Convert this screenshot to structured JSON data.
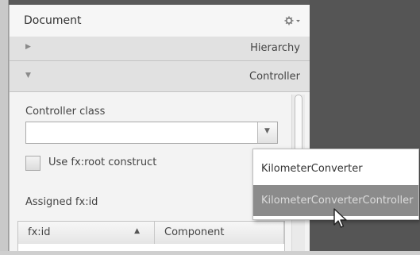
{
  "panel": {
    "title": "Document",
    "settings_icon": "gear-dropdown-icon",
    "sections": [
      {
        "label": "Hierarchy",
        "expanded": false
      },
      {
        "label": "Controller",
        "expanded": true
      }
    ]
  },
  "controller": {
    "class_label": "Controller class",
    "class_value": "",
    "root_construct_label": "Use fx:root construct",
    "root_construct_checked": false,
    "assigned_label": "Assigned fx:id",
    "table_columns": [
      "fx:id",
      "Component"
    ]
  },
  "dropdown": {
    "options": [
      "KilometerConverter",
      "KilometerConverterController"
    ],
    "hovered_index": 1
  }
}
